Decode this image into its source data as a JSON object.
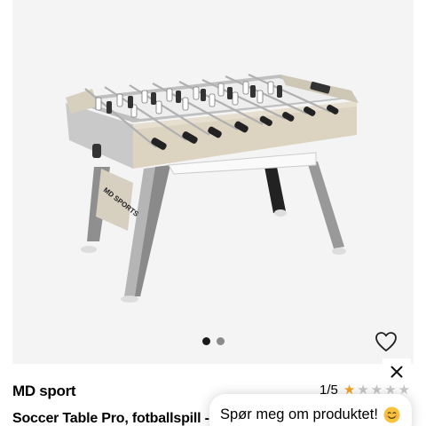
{
  "product": {
    "brand": "MD sport",
    "title": "Soccer Table Pro, fotballspill -",
    "rating_text": "1/5",
    "rating_value": 1,
    "rating_max": 5,
    "image_logo_text": "MD SPORTS"
  },
  "gallery": {
    "image_count": 2,
    "active_index": 0
  },
  "chat": {
    "prompt": "Spør meg om produktet!",
    "emoji": "smiling-face-emoji"
  },
  "icons": {
    "favorite": "heart-outline-icon",
    "close": "close-icon",
    "star": "star-icon"
  },
  "colors": {
    "star_filled": "#f4a31f",
    "star_empty": "#c8c8c8",
    "dot_active": "#1a1a1a",
    "dot_inactive": "#8a8a8a"
  }
}
